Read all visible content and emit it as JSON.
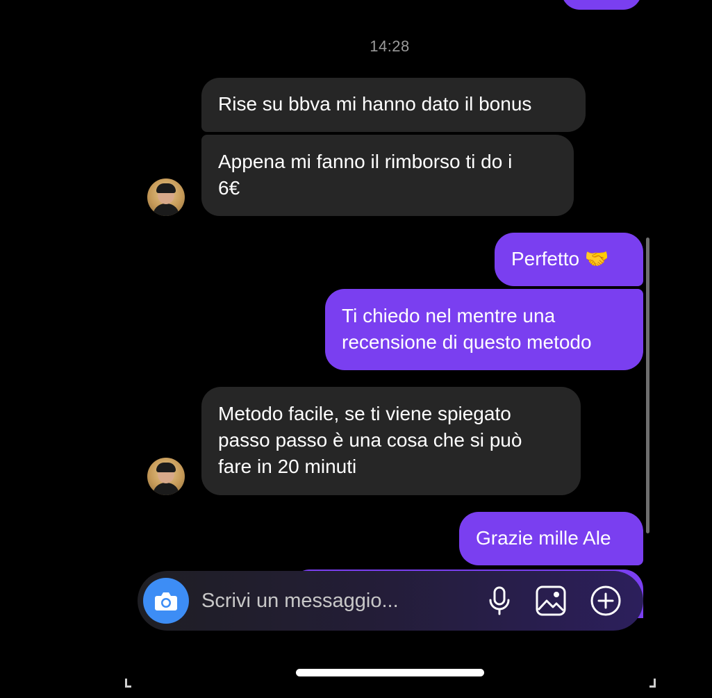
{
  "conversation": {
    "timestamp": "14:28",
    "messages": [
      {
        "sender": "them",
        "text": "Rise su bbva mi hanno dato il bonus"
      },
      {
        "sender": "them",
        "line1": "Appena mi fanno il rimborso ti do i",
        "line2": "6€"
      },
      {
        "sender": "me",
        "text": "Perfetto 🤝"
      },
      {
        "sender": "me",
        "line1": "Ti chiedo nel mentre una",
        "line2": "recensione di questo metodo"
      },
      {
        "sender": "them",
        "line1": "Metodo facile, se ti viene spiegato",
        "line2": "passo passo è una cosa che si può",
        "line3": "fare in 20 minuti"
      },
      {
        "sender": "me",
        "text": "Grazie mille Ale"
      }
    ]
  },
  "composer": {
    "placeholder": "Scrivi un messaggio..."
  },
  "colors": {
    "background": "#000000",
    "incoming_bubble": "#262626",
    "outgoing_bubble": "#7a3ff0",
    "camera_button": "#3d8df5",
    "timestamp_text": "#9a9a9a"
  },
  "icons": {
    "camera": "camera-icon",
    "microphone": "microphone-icon",
    "gallery": "image-icon",
    "more": "plus-circle-icon"
  }
}
